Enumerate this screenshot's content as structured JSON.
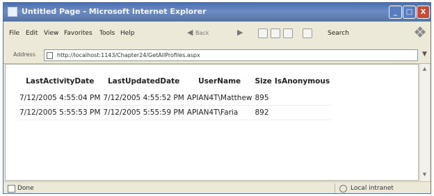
{
  "window": {
    "title": "Untitled Page - Microsoft Internet Explorer",
    "controls": {
      "minimize": "_",
      "maximize": "□",
      "close": "X"
    }
  },
  "menubar": {
    "items": [
      "File",
      "Edit",
      "View",
      "Favorites",
      "Tools",
      "Help"
    ],
    "back_label": "Back",
    "search_label": "Search"
  },
  "address": {
    "label": "Address",
    "url": "http://localhost:1143/Chapter24/GetAllProfiles.aspx"
  },
  "table": {
    "headers": [
      "LastActivityDate",
      "LastUpdatedDate",
      "UserName",
      "Size",
      "IsAnonymous"
    ],
    "rows": [
      [
        "7/12/2005 4:55:04 PM",
        "7/12/2005 4:55:52 PM",
        "APIAN4T\\Matthew",
        "895",
        ""
      ],
      [
        "7/12/2005 5:55:53 PM",
        "7/12/2005 5:55:59 PM",
        "APIAN4T\\Faria",
        "892",
        ""
      ]
    ]
  },
  "status": {
    "left": "Done",
    "zone": "Local intranet"
  }
}
